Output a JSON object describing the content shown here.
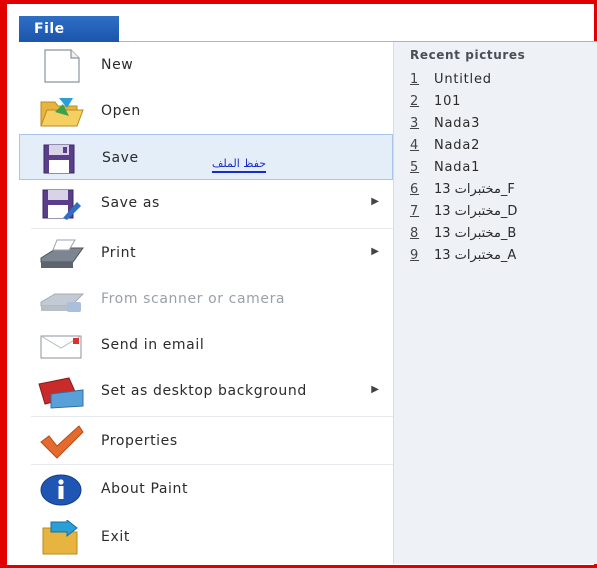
{
  "file_tab": {
    "label": "File"
  },
  "menu": {
    "items": [
      {
        "label": "New",
        "icon": "new-file-icon",
        "has_submenu": false
      },
      {
        "label": "Open",
        "icon": "open-folder-icon",
        "has_submenu": false
      },
      {
        "label": "Save",
        "icon": "save-icon",
        "has_submenu": false,
        "selected": true
      },
      {
        "label": "Save as",
        "icon": "save-as-icon",
        "has_submenu": true
      },
      {
        "label": "Print",
        "icon": "print-icon",
        "has_submenu": true
      },
      {
        "label": "From scanner or camera",
        "icon": "scanner-icon",
        "has_submenu": false,
        "disabled": true
      },
      {
        "label": "Send in email",
        "icon": "email-icon",
        "has_submenu": false
      },
      {
        "label": "Set as desktop background",
        "icon": "desktop-background-icon",
        "has_submenu": true
      },
      {
        "label": "Properties",
        "icon": "properties-checkmark-icon",
        "has_submenu": false
      },
      {
        "label": "About Paint",
        "icon": "info-icon",
        "has_submenu": false
      },
      {
        "label": "Exit",
        "icon": "exit-icon",
        "has_submenu": false
      }
    ],
    "annotation": "حفظ الملف"
  },
  "recent": {
    "title": "Recent pictures",
    "items": [
      {
        "num": "1",
        "name": "Untitled"
      },
      {
        "num": "2",
        "name": "101"
      },
      {
        "num": "3",
        "name": "Nada3"
      },
      {
        "num": "4",
        "name": "Nada2"
      },
      {
        "num": "5",
        "name": "Nada1"
      },
      {
        "num": "6",
        "name": "مختبرات 13_F"
      },
      {
        "num": "7",
        "name": "مختبرات 13_D"
      },
      {
        "num": "8",
        "name": "مختبرات 13_B"
      },
      {
        "num": "9",
        "name": "مختبرات 13_A"
      }
    ]
  },
  "colors": {
    "accent": "#1b55ac",
    "frame": "#e00000",
    "selected_bg": "#e4eef9"
  }
}
